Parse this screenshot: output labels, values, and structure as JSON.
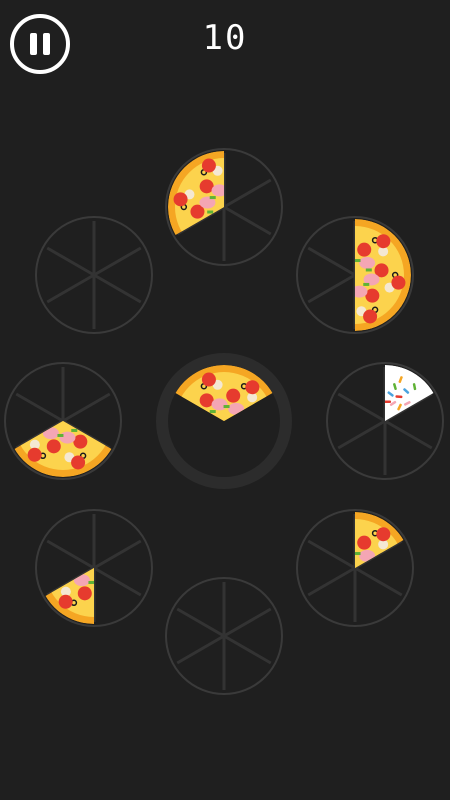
{
  "hud": {
    "score": "10",
    "pause_icon": "pause-icon"
  },
  "colors": {
    "background": "#1f1f1f",
    "plate_ring": "#3a3a3a",
    "plate_spokes": "#333333",
    "center_ring": "#2c2c2c",
    "crust": "#f5a623",
    "cheese": "#fcd34d",
    "tomato": "#e63b2e",
    "ham": "#f4a6b4",
    "mushroom": "#f4e8d3",
    "olive": "#1b1b1b",
    "basil": "#5fb236",
    "cake_frosting": "#ffffff"
  },
  "plates": [
    {
      "id": "plate-top",
      "slices": [
        {
          "from": 4,
          "to": 6,
          "type": "pizza"
        }
      ]
    },
    {
      "id": "plate-upper-left",
      "slices": []
    },
    {
      "id": "plate-upper-right",
      "slices": [
        {
          "from": 0,
          "to": 3,
          "type": "pizza"
        }
      ]
    },
    {
      "id": "plate-middle-left",
      "slices": [
        {
          "from": 2,
          "to": 4,
          "type": "pizza"
        }
      ]
    },
    {
      "id": "plate-center",
      "slices": [
        {
          "from": 5,
          "to": 7,
          "type": "pizza"
        }
      ]
    },
    {
      "id": "plate-middle-right",
      "slices": [
        {
          "from": 0,
          "to": 1,
          "type": "cake"
        }
      ]
    },
    {
      "id": "plate-lower-left",
      "slices": [
        {
          "from": 3,
          "to": 4,
          "type": "pizza"
        }
      ]
    },
    {
      "id": "plate-lower-right",
      "slices": [
        {
          "from": 0,
          "to": 1,
          "type": "pizza"
        }
      ]
    },
    {
      "id": "plate-bottom",
      "slices": []
    }
  ]
}
